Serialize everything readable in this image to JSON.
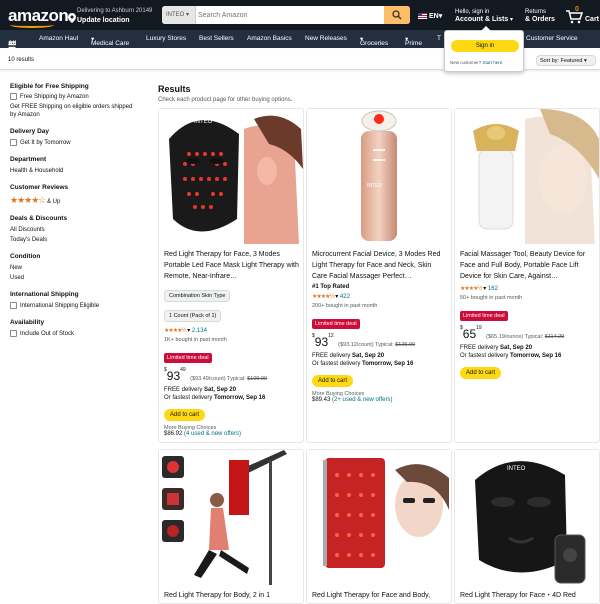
{
  "header": {
    "logo": "amazon",
    "deliver_line1": "Delivering to Ashburn 20149",
    "deliver_line2": "Update location",
    "search_category": "INTEO",
    "search_placeholder": "Search Amazon",
    "language": "EN",
    "account_line1": "Hello, sign in",
    "account_line2": "Account & Lists",
    "returns_line1": "Returns",
    "returns_line2": "& Orders",
    "cart_count": "0",
    "cart_label": "Cart"
  },
  "nav": {
    "all": "All",
    "items": [
      "Amazon Haul",
      "Medical Care",
      "Luxury Stores",
      "Best Sellers",
      "Amazon Basics",
      "New Releases",
      "Groceries",
      "Prime",
      "T",
      "Customer Service"
    ]
  },
  "popup": {
    "signin": "Sign in",
    "new_customer": "New customer?",
    "start_here": "Start here."
  },
  "results_bar": {
    "count": "10 results",
    "sort": "Sort by: Featured"
  },
  "sidebar": {
    "free_shipping_title": "Eligible for Free Shipping",
    "free_shipping_option": "Free Shipping by Amazon",
    "free_shipping_note": "Get FREE Shipping on eligible orders shipped by Amazon",
    "delivery_title": "Delivery Day",
    "delivery_option": "Get It by Tomorrow",
    "department_title": "Department",
    "department_item": "Health & Household",
    "reviews_title": "Customer Reviews",
    "reviews_up": "& Up",
    "deals_title": "Deals & Discounts",
    "deals_1": "All Discounts",
    "deals_2": "Today's Deals",
    "condition_title": "Condition",
    "condition_1": "New",
    "condition_2": "Used",
    "intl_title": "International Shipping",
    "intl_option": "International Shipping Eligible",
    "avail_title": "Availability",
    "avail_option": "Include Out of Stock"
  },
  "main": {
    "title": "Results",
    "subtitle": "Check each product page for other buying options."
  },
  "products": [
    {
      "title": "Red Light Therapy for Face, 3 Modes Portable Led Face Mask Light Therapy with Remote, Near-Infrare…",
      "chip1": "Combination Skin Type",
      "chip2": "1 Count (Pack of 1)",
      "reviews": "2,134",
      "bought": "1K+ bought in past month",
      "deal": "Limited time deal",
      "price_whole": "93",
      "price_frac": "49",
      "unit": "($93.49/count) Typical: ",
      "typical": "$109.99",
      "delivery": "FREE delivery ",
      "delivery_date": "Sat, Sep 20",
      "fastest": "Or fastest delivery ",
      "fastest_date": "Tomorrow, Sep 16",
      "add": "Add to cart",
      "more": "More Buying Choices",
      "offers_price": "$86.92 ",
      "offers_link": "(4 used & new offers)"
    },
    {
      "title": "Microcurrent Facial Device, 3 Modes Red Light Therapy for Face and Neck, Skin Care Facial Massager Perfect…",
      "toprated": "#1 Top Rated",
      "reviews": "422",
      "bought": "200+ bought in past month",
      "deal": "Limited time deal",
      "price_whole": "93",
      "price_frac": "12",
      "unit": "($93.12/count) Typical: ",
      "typical": "$125.99",
      "delivery": "FREE delivery ",
      "delivery_date": "Sat, Sep 20",
      "fastest": "Or fastest delivery ",
      "fastest_date": "Tomorrow, Sep 16",
      "add": "Add to cart",
      "more": "More Buying Choices",
      "offers_price": "$89.43 ",
      "offers_link": "(2+ used & new offers)"
    },
    {
      "title": "Facial Massager Tool, Beauty Device for Face and Full Body, Portable Face Lift Device for Skin Care, Against…",
      "reviews": "162",
      "bought": "50+ bought in past month",
      "deal": "Limited time deal",
      "price_whole": "65",
      "price_frac": "19",
      "unit": "($65.19/ounce) Typical: ",
      "typical": "$114.29",
      "delivery": "FREE delivery ",
      "delivery_date": "Sat, Sep 20",
      "fastest": "Or fastest delivery ",
      "fastest_date": "Tomorrow, Sep 16",
      "add": "Add to cart"
    },
    {
      "title": "Red Light Therapy for Body, 2 in 1"
    },
    {
      "title": "Red Light Therapy for Face and Body,"
    },
    {
      "title": "Red Light Therapy for Face・4D Red"
    }
  ],
  "colors": {
    "header_bg": "#131921",
    "nav_bg": "#232f3e",
    "accent": "#febd69",
    "button_yellow": "#ffd814",
    "deal_red": "#cc0c39",
    "link": "#007185",
    "star": "#de7921"
  }
}
